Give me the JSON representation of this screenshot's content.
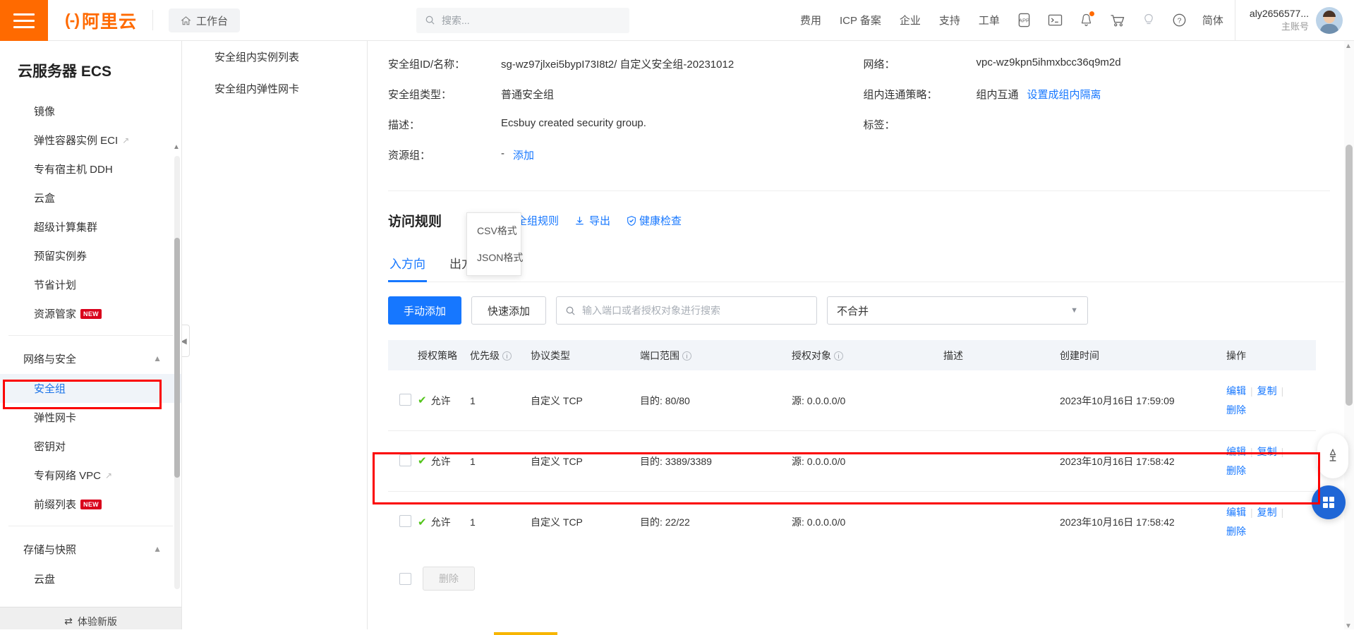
{
  "header": {
    "menu_icon": "hamburger-icon",
    "logo_text": "阿里云",
    "workbench": "工作台",
    "search_placeholder": "搜索...",
    "links": [
      "费用",
      "ICP 备案",
      "企业",
      "支持",
      "工单"
    ],
    "icons": [
      "app-icon",
      "terminal-icon",
      "bell-icon",
      "cart-icon",
      "lightbulb-icon",
      "help-icon"
    ],
    "language": "简体",
    "account_name": "aly2656577...",
    "account_type": "主账号"
  },
  "sidebar": {
    "title": "云服务器 ECS",
    "items": [
      {
        "label": "镜像",
        "external": false,
        "badge": ""
      },
      {
        "label": "弹性容器实例 ECI",
        "external": true,
        "badge": ""
      },
      {
        "label": "专有宿主机 DDH",
        "external": false,
        "badge": ""
      },
      {
        "label": "云盒",
        "external": false,
        "badge": ""
      },
      {
        "label": "超级计算集群",
        "external": false,
        "badge": ""
      },
      {
        "label": "预留实例券",
        "external": false,
        "badge": ""
      },
      {
        "label": "节省计划",
        "external": false,
        "badge": ""
      },
      {
        "label": "资源管家",
        "external": false,
        "badge": "NEW"
      }
    ],
    "group_network": "网络与安全",
    "network_items": [
      {
        "label": "安全组",
        "external": false,
        "badge": "",
        "selected": true
      },
      {
        "label": "弹性网卡",
        "external": false,
        "badge": "",
        "selected": false
      },
      {
        "label": "密钥对",
        "external": false,
        "badge": "",
        "selected": false
      },
      {
        "label": "专有网络 VPC",
        "external": true,
        "badge": "",
        "selected": false
      },
      {
        "label": "前缀列表",
        "external": false,
        "badge": "NEW",
        "selected": false
      }
    ],
    "group_storage": "存储与快照",
    "storage_items": [
      {
        "label": "云盘",
        "external": false,
        "badge": "",
        "selected": false
      }
    ],
    "new_version": "体验新版"
  },
  "subnav": {
    "items": [
      "安全组内实例列表",
      "安全组内弹性网卡"
    ]
  },
  "detail": {
    "left": [
      {
        "label": "安全组ID/名称：",
        "value": "sg-wz97jlxei5bypI73I8t2/ 自定义安全组-20231012",
        "link": ""
      },
      {
        "label": "安全组类型：",
        "value": "普通安全组",
        "link": ""
      },
      {
        "label": "描述：",
        "value": "Ecsbuy created security group.",
        "link": ""
      },
      {
        "label": "资源组：",
        "value": "-",
        "link": "添加"
      }
    ],
    "right": [
      {
        "label": "网络：",
        "value": "vpc-wz9kpn5ihmxbcc36q9m2d",
        "link": ""
      },
      {
        "label": "组内连通策略：",
        "value": "组内互通",
        "link": "设置成组内隔离"
      },
      {
        "label": "标签：",
        "value": "",
        "link": ""
      }
    ]
  },
  "rules": {
    "title": "访问规则",
    "import_label": "导入安全组规则",
    "export_label": "导出",
    "healthcheck_label": "健康检查",
    "export_menu": [
      "CSV格式",
      "JSON格式"
    ],
    "tabs": [
      {
        "label": "入方向",
        "selected": true
      },
      {
        "label": "出方向",
        "selected": false
      }
    ],
    "toolbar": {
      "manual_add": "手动添加",
      "quick_add": "快速添加",
      "search_placeholder": "输入端口或者授权对象进行搜索",
      "merge_select": "不合并"
    },
    "columns": [
      "授权策略",
      "优先级",
      "协议类型",
      "端口范围",
      "授权对象",
      "描述",
      "创建时间",
      "操作"
    ],
    "columns_info": [
      false,
      true,
      false,
      true,
      true,
      false,
      false,
      false
    ],
    "rows": [
      {
        "policy": "允许",
        "priority": "1",
        "protocol": "自定义 TCP",
        "port": "目的: 80/80",
        "auth": "源: 0.0.0.0/0",
        "desc": "",
        "time": "2023年10月16日 17:59:09",
        "ops": [
          "编辑",
          "复制",
          "删除"
        ],
        "highlighted": false
      },
      {
        "policy": "允许",
        "priority": "1",
        "protocol": "自定义 TCP",
        "port": "目的: 3389/3389",
        "auth": "源: 0.0.0.0/0",
        "desc": "",
        "time": "2023年10月16日 17:58:42",
        "ops": [
          "编辑",
          "复制",
          "删除"
        ],
        "highlighted": true
      },
      {
        "policy": "允许",
        "priority": "1",
        "protocol": "自定义 TCP",
        "port": "目的: 22/22",
        "auth": "源: 0.0.0.0/0",
        "desc": "",
        "time": "2023年10月16日 17:58:42",
        "ops": [
          "编辑",
          "复制",
          "删除"
        ],
        "highlighted": false
      }
    ],
    "footer_delete": "删除"
  },
  "colors": {
    "brand_orange": "#FF6A00",
    "link_blue": "#1677ff",
    "primary_button": "#1677ff",
    "annotation_red": "#fb0000",
    "badge_red": "#d9001b",
    "success_green": "#52c41a"
  }
}
